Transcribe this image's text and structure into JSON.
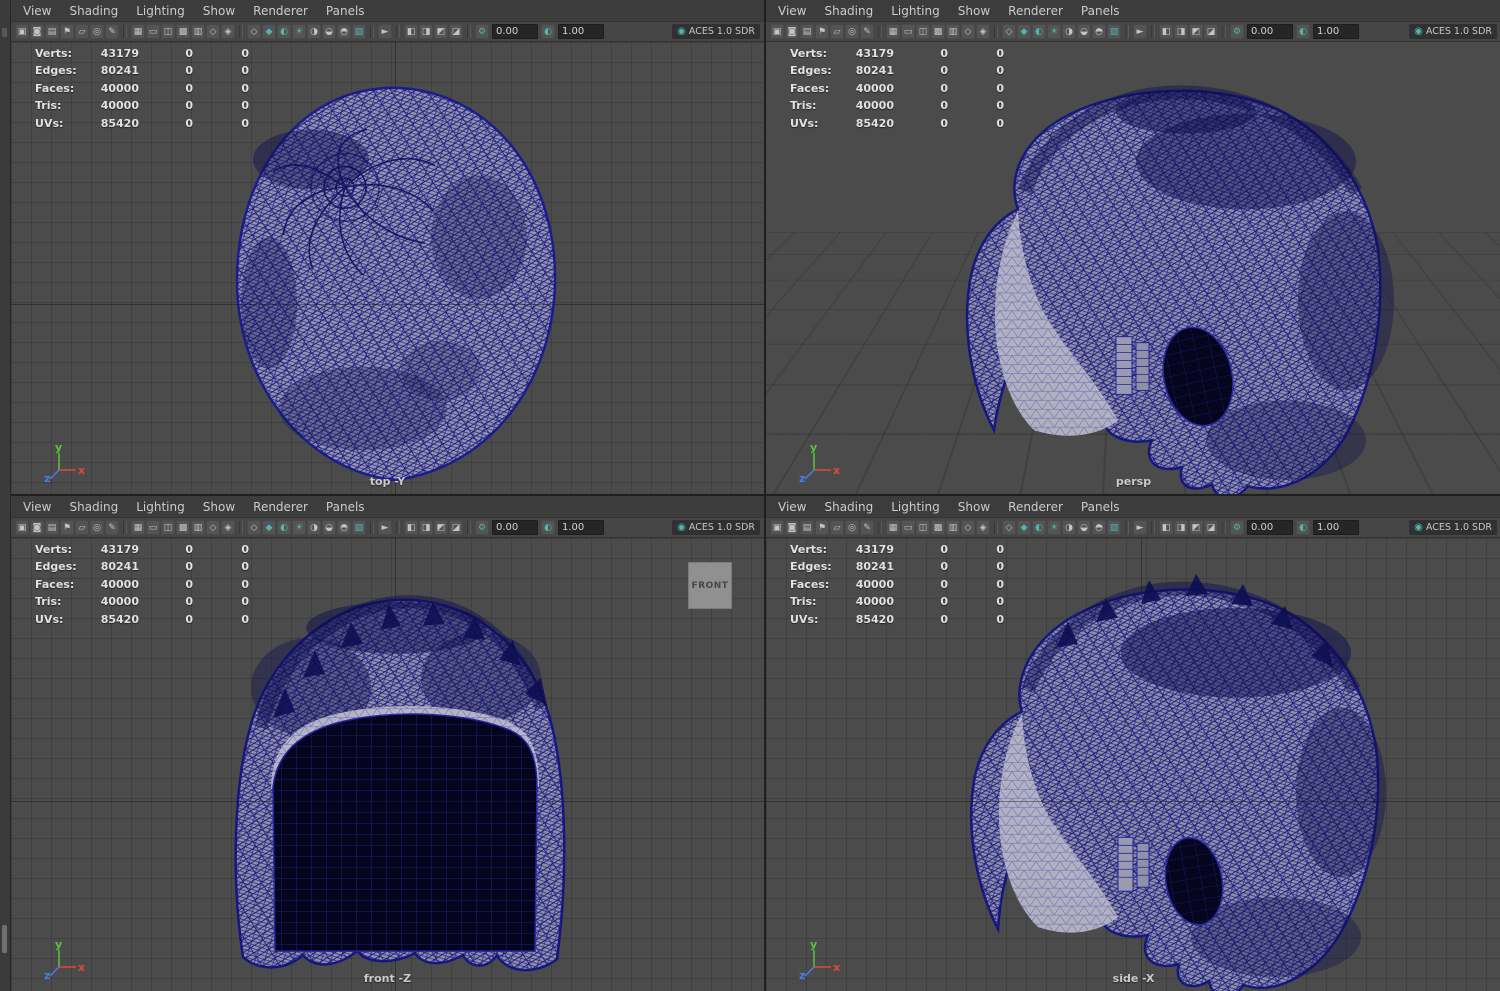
{
  "panel_menus": [
    "View",
    "Shading",
    "Lighting",
    "Show",
    "Renderer",
    "Panels"
  ],
  "toolbar": {
    "exposure_value": "0.00",
    "gamma_value": "1.00",
    "colorspace_label": "ACES 1.0 SDR",
    "icons": [
      {
        "name": "camera-select-icon",
        "glyph": "▣"
      },
      {
        "name": "camera-lock-icon",
        "glyph": "◙"
      },
      {
        "name": "camera-attributes-icon",
        "glyph": "▤"
      },
      {
        "name": "bookmark-icon",
        "glyph": "⚑"
      },
      {
        "name": "image-plane-icon",
        "glyph": "▱"
      },
      {
        "name": "pan-zoom-icon",
        "glyph": "◎"
      },
      {
        "name": "grease-pencil-icon",
        "glyph": "✎"
      },
      {
        "sep": true
      },
      {
        "name": "grid-icon",
        "glyph": "▦"
      },
      {
        "name": "film-gate-icon",
        "glyph": "▭"
      },
      {
        "name": "resolution-gate-icon",
        "glyph": "◫"
      },
      {
        "name": "gate-mask-icon",
        "glyph": "▩"
      },
      {
        "name": "field-chart-icon",
        "glyph": "▥"
      },
      {
        "name": "safe-action-icon",
        "glyph": "◇"
      },
      {
        "name": "safe-title-icon",
        "glyph": "◈"
      },
      {
        "sep": true
      },
      {
        "name": "wireframe-icon",
        "glyph": "◇"
      },
      {
        "name": "shaded-icon",
        "glyph": "◆",
        "teal": true
      },
      {
        "name": "textured-icon",
        "glyph": "◐",
        "teal": true
      },
      {
        "name": "lights-icon",
        "glyph": "☀",
        "teal": true
      },
      {
        "name": "shadows-icon",
        "glyph": "◑"
      },
      {
        "name": "ambient-occlusion-icon",
        "glyph": "◒"
      },
      {
        "name": "motion-blur-icon",
        "glyph": "◓"
      },
      {
        "name": "anti-alias-icon",
        "glyph": "▨",
        "teal": true
      },
      {
        "sep": true
      },
      {
        "name": "isolate-select-icon",
        "glyph": "►"
      },
      {
        "sep": true
      },
      {
        "name": "xray-icon",
        "glyph": "◧"
      },
      {
        "name": "xray-joints-icon",
        "glyph": "◨"
      },
      {
        "name": "backface-culling-icon",
        "glyph": "◩"
      },
      {
        "name": "wire-on-shaded-icon",
        "glyph": "◪"
      },
      {
        "sep": true
      },
      {
        "name": "display-settings-icon",
        "glyph": "⚙",
        "teal": true
      }
    ]
  },
  "hud": {
    "rows": [
      {
        "label": "Verts:",
        "value": "43179",
        "col1": "0",
        "col2": "0"
      },
      {
        "label": "Edges:",
        "value": "80241",
        "col1": "0",
        "col2": "0"
      },
      {
        "label": "Faces:",
        "value": "40000",
        "col1": "0",
        "col2": "0"
      },
      {
        "label": "Tris:",
        "value": "40000",
        "col1": "0",
        "col2": "0"
      },
      {
        "label": "UVs:",
        "value": "85420",
        "col1": "0",
        "col2": "0"
      }
    ]
  },
  "viewports": [
    {
      "label": "top -Y"
    },
    {
      "label": "persp"
    },
    {
      "label": "front -Z"
    },
    {
      "label": "side -X"
    }
  ],
  "front_plane_label": "FRONT",
  "axis": {
    "x": "x",
    "y": "y",
    "z": "z"
  },
  "colors": {
    "wire_blue": "#2222a0",
    "accent_teal": "#4fb6b2",
    "axis_x": "#de4a38",
    "axis_y": "#58c43c",
    "axis_z": "#4b7bec"
  }
}
